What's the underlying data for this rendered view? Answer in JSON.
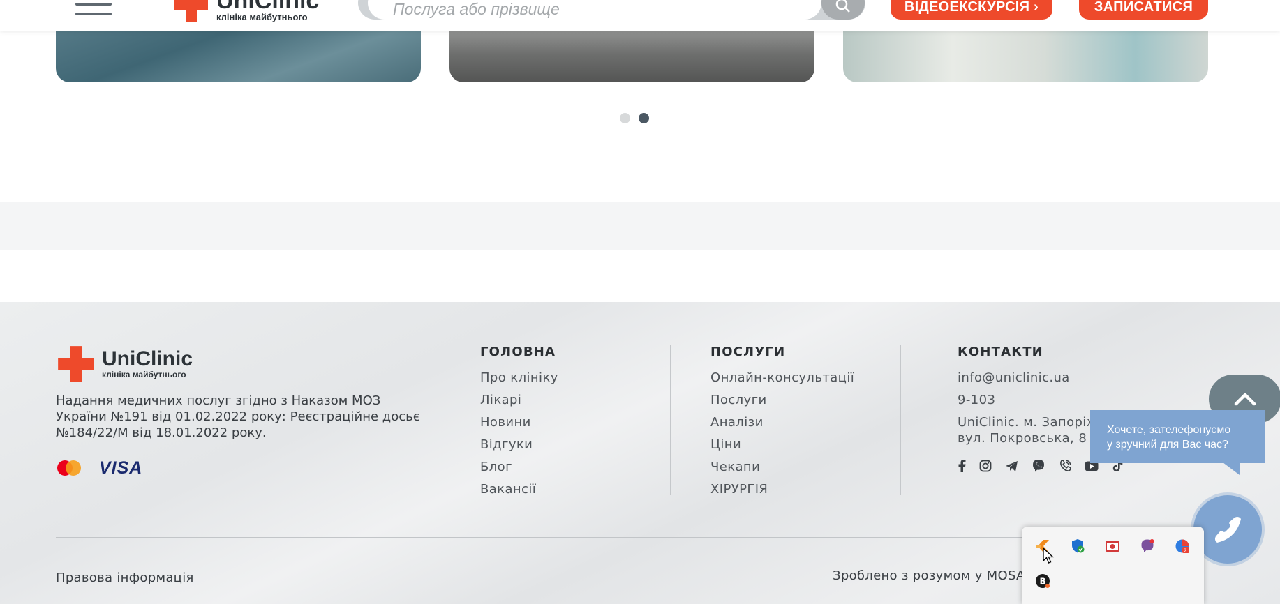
{
  "header": {
    "logo_brand": "UniClinic",
    "logo_tagline": "клініка майбутнього",
    "search_placeholder": "Послуга або прізвище",
    "videotour_label": "ВІДЕОЕКСКУРСІЯ ›",
    "book_label": "ЗАПИСАТИСЯ"
  },
  "carousel": {
    "dots": 2,
    "active_dot": 2
  },
  "footer": {
    "logo_brand": "UniClinic",
    "logo_tagline": "клініка майбутнього",
    "license_text": "Надання медичних послуг згідно з Наказом МОЗ України №191 від 01.02.2022 року: Реєстраційне досьє №184/22/М від 18.01.2022 року.",
    "payment": {
      "visa": "VISA"
    },
    "col_main": {
      "title": "ГОЛОВНА",
      "links": [
        "Про клініку",
        "Лікарі",
        "Новини",
        "Відгуки",
        "Блог",
        "Вакансії"
      ]
    },
    "col_services": {
      "title": "ПОСЛУГИ",
      "links": [
        "Онлайн-консультації",
        "Послуги",
        "Аналізи",
        "Ціни",
        "Чекапи",
        "ХІРУРГІЯ"
      ]
    },
    "col_contacts": {
      "title": "КОНТАКТИ",
      "email": "info@uniclinic.ua",
      "phone": "9-103",
      "address_line1": "UniClinic. м. Запоріжжя,",
      "address_line2": "вул. Покровська, 8",
      "socials": [
        "facebook-icon",
        "instagram-icon",
        "telegram-icon",
        "viber-icon",
        "phone-icon",
        "youtube-icon",
        "tiktok-icon"
      ]
    },
    "legal_link": "Правова інформація",
    "made_by": "Зроблено з розумом у MOSA"
  },
  "callback": {
    "bubble_line1": "Хочете, зателефонуємо",
    "bubble_line2": "у зручний для Вас час?"
  },
  "colors": {
    "accent": "#ee4a2b",
    "callback": "#7fa4d1",
    "scroll_top": "#6e8088"
  }
}
